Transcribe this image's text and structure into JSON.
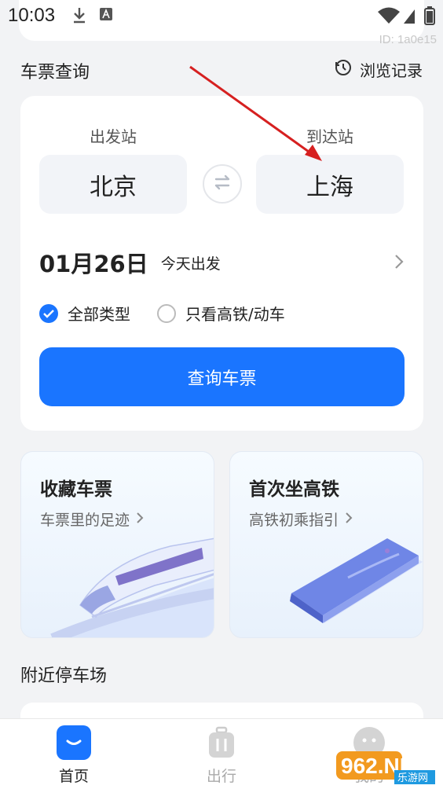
{
  "status_bar": {
    "time": "10:03"
  },
  "watermark": "ID: 1a0e15",
  "ticket_query": {
    "section_title": "车票查询",
    "history_label": "浏览记录",
    "from_label": "出发站",
    "from_station": "北京",
    "to_label": "到达站",
    "to_station": "上海",
    "date": "01月26日",
    "date_note": "今天出发",
    "option_all": "全部类型",
    "option_hsr": "只看高铁/动车",
    "query_button": "查询车票"
  },
  "features": [
    {
      "title": "收藏车票",
      "subtitle": "车票里的足迹",
      "icon": "train-illustration"
    },
    {
      "title": "首次坐高铁",
      "subtitle": "高铁初乘指引",
      "icon": "book-illustration"
    }
  ],
  "nearby_parking": {
    "title": "附近停车场"
  },
  "tabbar": {
    "items": [
      {
        "label": "首页",
        "icon": "home-icon",
        "active": true
      },
      {
        "label": "出行",
        "icon": "luggage-icon",
        "active": false
      },
      {
        "label": "我的",
        "icon": "profile-icon",
        "active": false
      }
    ]
  },
  "logo": {
    "text": "962.NET",
    "sub": "乐游网"
  },
  "colors": {
    "accent": "#1a75ff",
    "background": "#f2f3f5",
    "annotation_arrow": "#d62020"
  }
}
